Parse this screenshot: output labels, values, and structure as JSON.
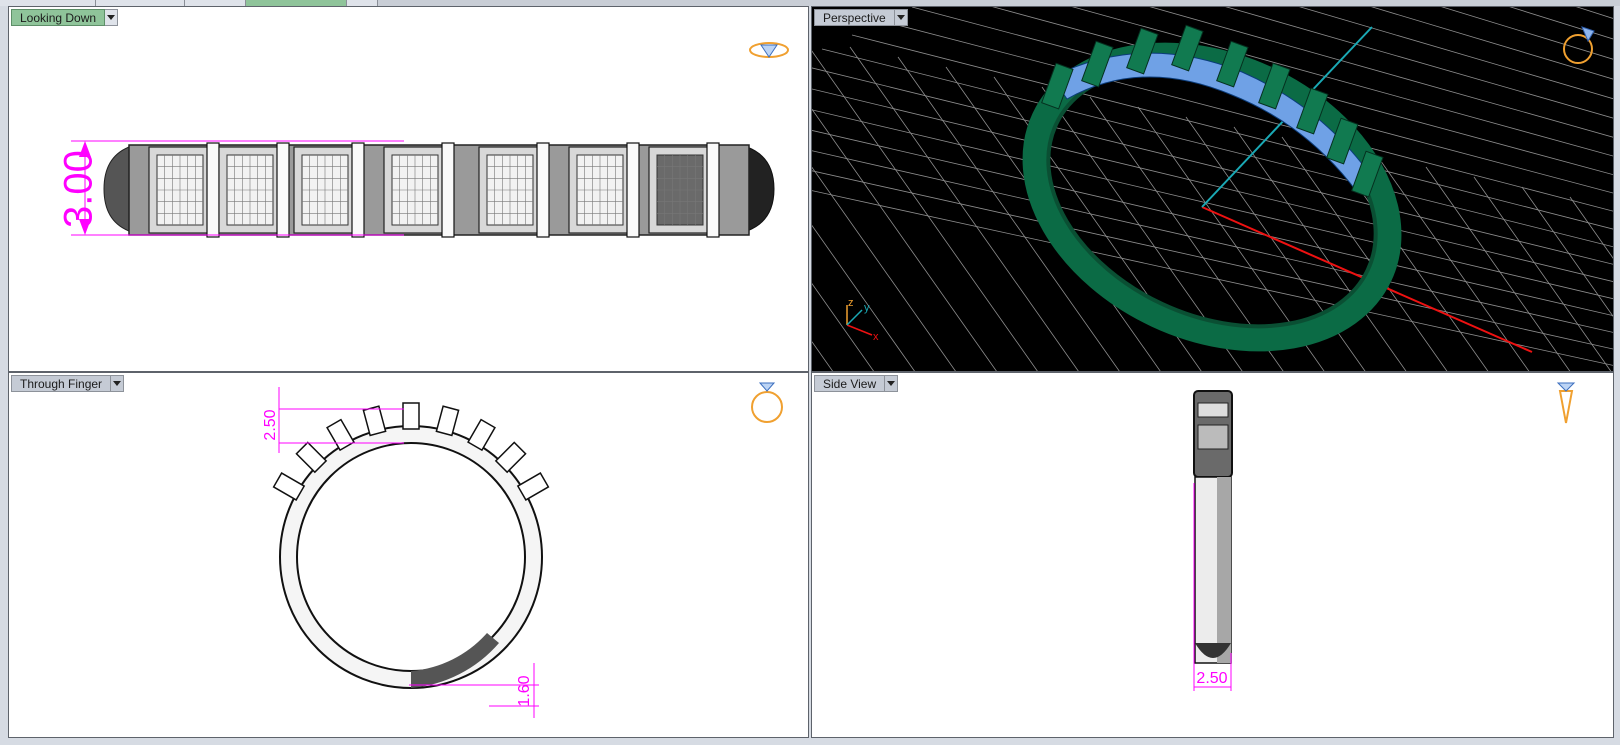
{
  "viewports": {
    "top_left": {
      "label": "Looking Down",
      "active": true,
      "dimension": "3.00"
    },
    "top_right": {
      "label": "Perspective",
      "active": false,
      "axes": {
        "z": "z",
        "y": "y",
        "x": "x"
      }
    },
    "bottom_left": {
      "label": "Through Finger",
      "active": false,
      "dim_top": "2.50",
      "dim_bottom": "1.60"
    },
    "bottom_right": {
      "label": "Side View",
      "active": false,
      "dimension": "2.50"
    }
  },
  "colors": {
    "dimension": "#ff00ff",
    "ring_green": "#0b6b45",
    "gem_blue": "#6fa1e6",
    "grid": "#9a9a9a",
    "icon_orange": "#f0a030"
  }
}
